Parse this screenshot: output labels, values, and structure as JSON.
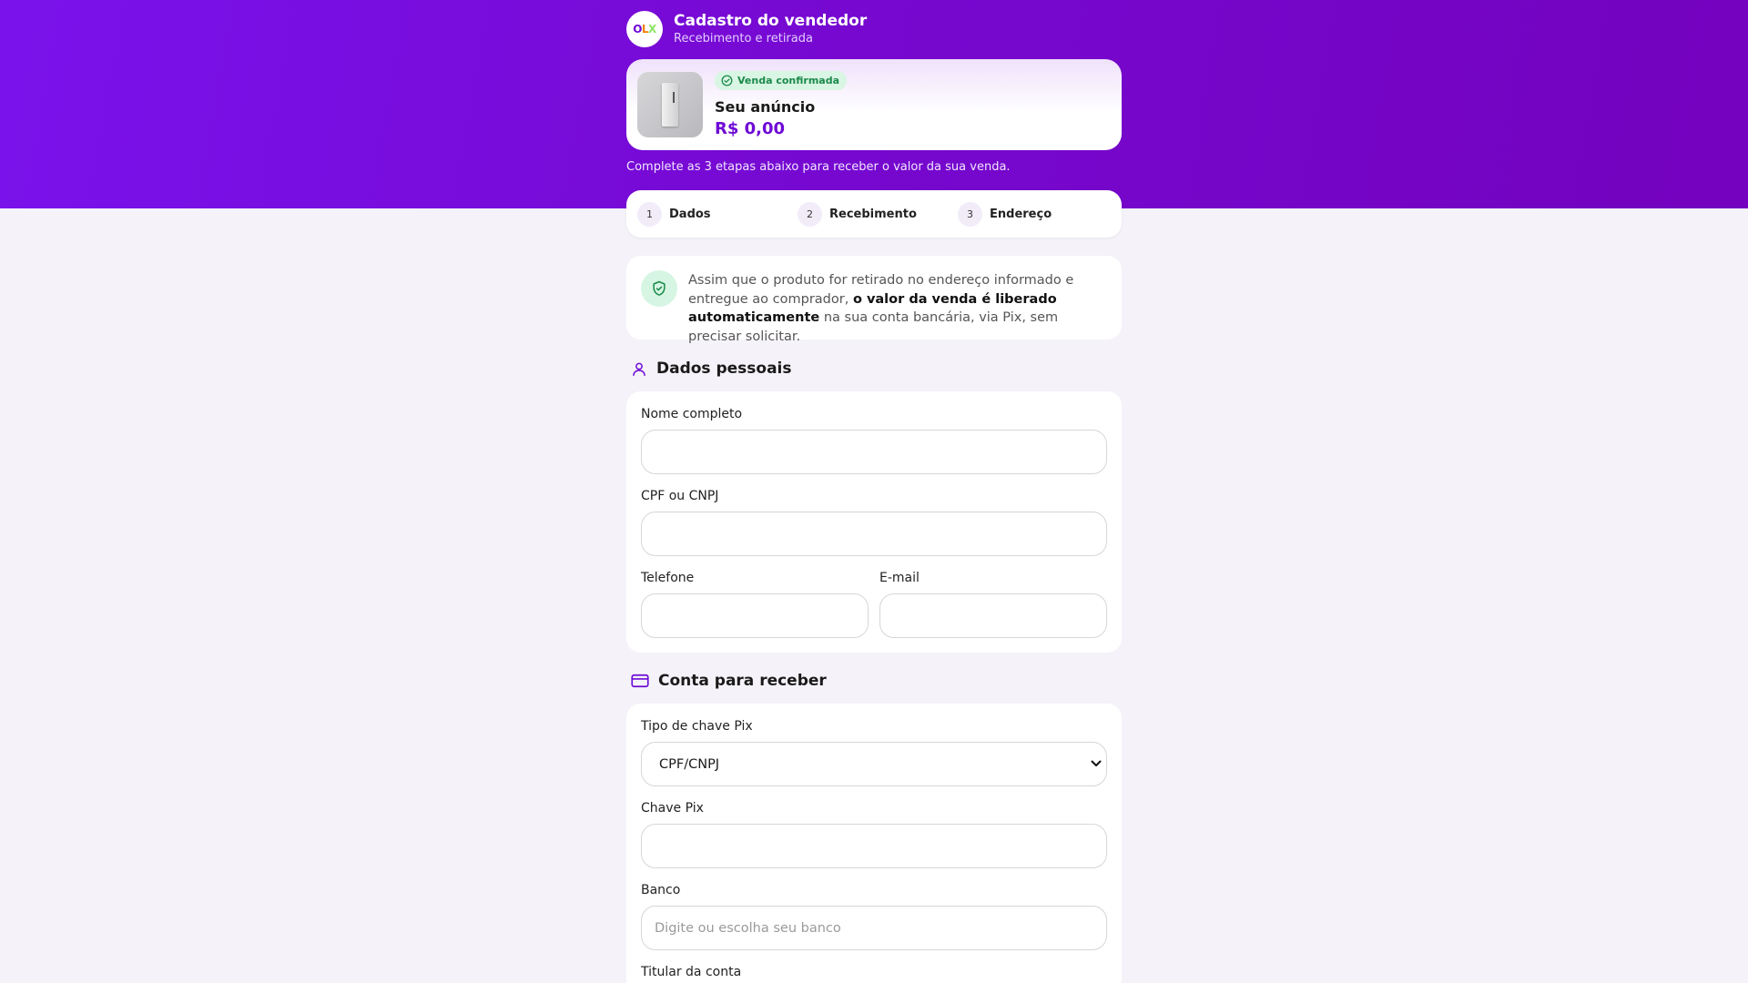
{
  "header": {
    "logo_o": "O",
    "logo_l": "L",
    "logo_x": "X",
    "title": "Cadastro do vendedor",
    "subtitle": "Recebimento e retirada"
  },
  "product": {
    "badge": "Venda confirmada",
    "title": "Seu anúncio",
    "price": "R$ 0,00"
  },
  "steps_note": "Complete as 3 etapas abaixo para receber o valor da sua venda.",
  "steps": [
    {
      "num": "1",
      "label": "Dados"
    },
    {
      "num": "2",
      "label": "Recebimento"
    },
    {
      "num": "3",
      "label": "Endereço"
    }
  ],
  "info": {
    "text_before": "Assim que o produto for retirado no endereço informado e entregue ao comprador, ",
    "text_bold": "o valor da venda é liberado automaticamente",
    "text_after": " na sua conta bancária, via Pix, sem precisar solicitar."
  },
  "personal": {
    "title": "Dados pessoais",
    "name_label": "Nome completo",
    "name_value": "",
    "doc_label": "CPF ou CNPJ",
    "doc_value": "",
    "phone_label": "Telefone",
    "phone_value": "",
    "email_label": "E-mail",
    "email_value": ""
  },
  "account": {
    "title": "Conta para receber",
    "pix_type_label": "Tipo de chave Pix",
    "pix_type_value": "CPF/CNPJ",
    "pix_key_label": "Chave Pix",
    "pix_key_value": "",
    "bank_label": "Banco",
    "bank_placeholder": "Digite ou escolha seu banco",
    "holder_label": "Titular da conta"
  },
  "colors": {
    "brand": "#6e0ad6",
    "success": "#1b8a4a"
  }
}
